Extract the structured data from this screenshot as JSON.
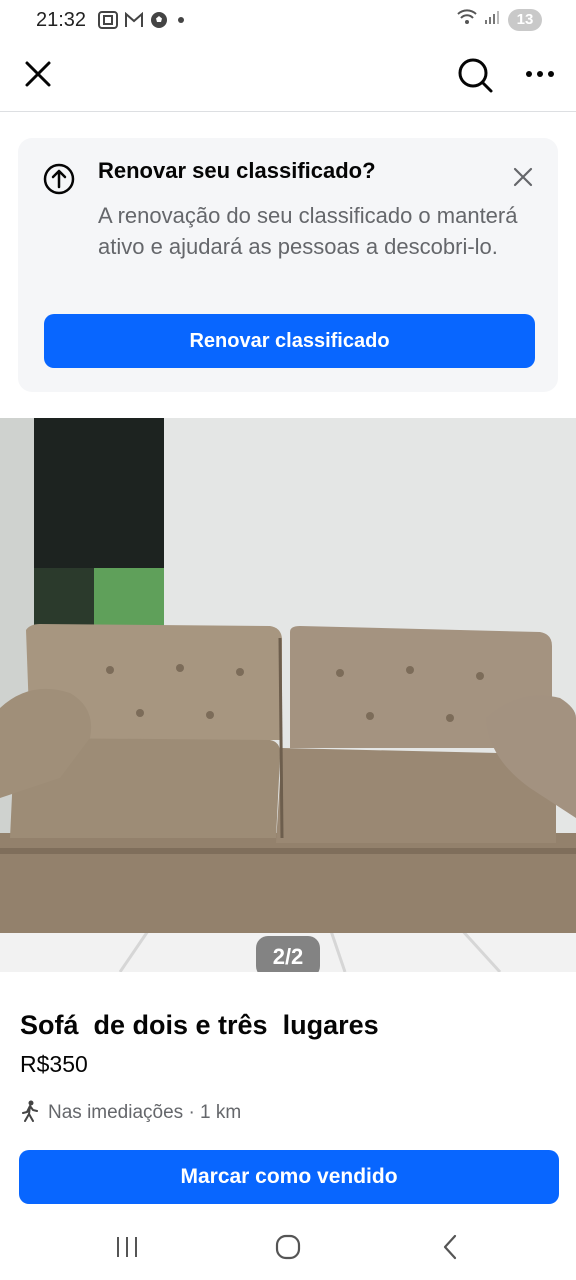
{
  "status_bar": {
    "time": "21:32",
    "battery": "13",
    "icons_left": [
      "screenshot-icon",
      "gmail-icon",
      "soccer-ball-icon",
      "notification-dot"
    ],
    "icons_right": [
      "wifi-icon",
      "signal-icon",
      "battery-icon"
    ]
  },
  "top_nav": {
    "close_icon": "close-icon",
    "search_icon": "search-icon",
    "more_icon": "more-options-icon"
  },
  "renew_card": {
    "title": "Renovar seu classificado?",
    "description": "A renovação do seu classificado o manterá ativo e ajudará as pessoas a descobri-lo.",
    "button_label": "Renovar classificado",
    "icon": "arrow-up-circle-icon"
  },
  "photo": {
    "counter": "2/2"
  },
  "listing": {
    "title": "Sofá  de dois e três  lugares",
    "price": "R$350",
    "location": "Nas imediações · 1 km",
    "location_icon": "walking-person-icon"
  },
  "actions": {
    "mark_sold_label": "Marcar como vendido"
  },
  "colors": {
    "primary": "#0866ff",
    "card_background": "#f5f6f8",
    "secondary_text": "#65676b"
  }
}
